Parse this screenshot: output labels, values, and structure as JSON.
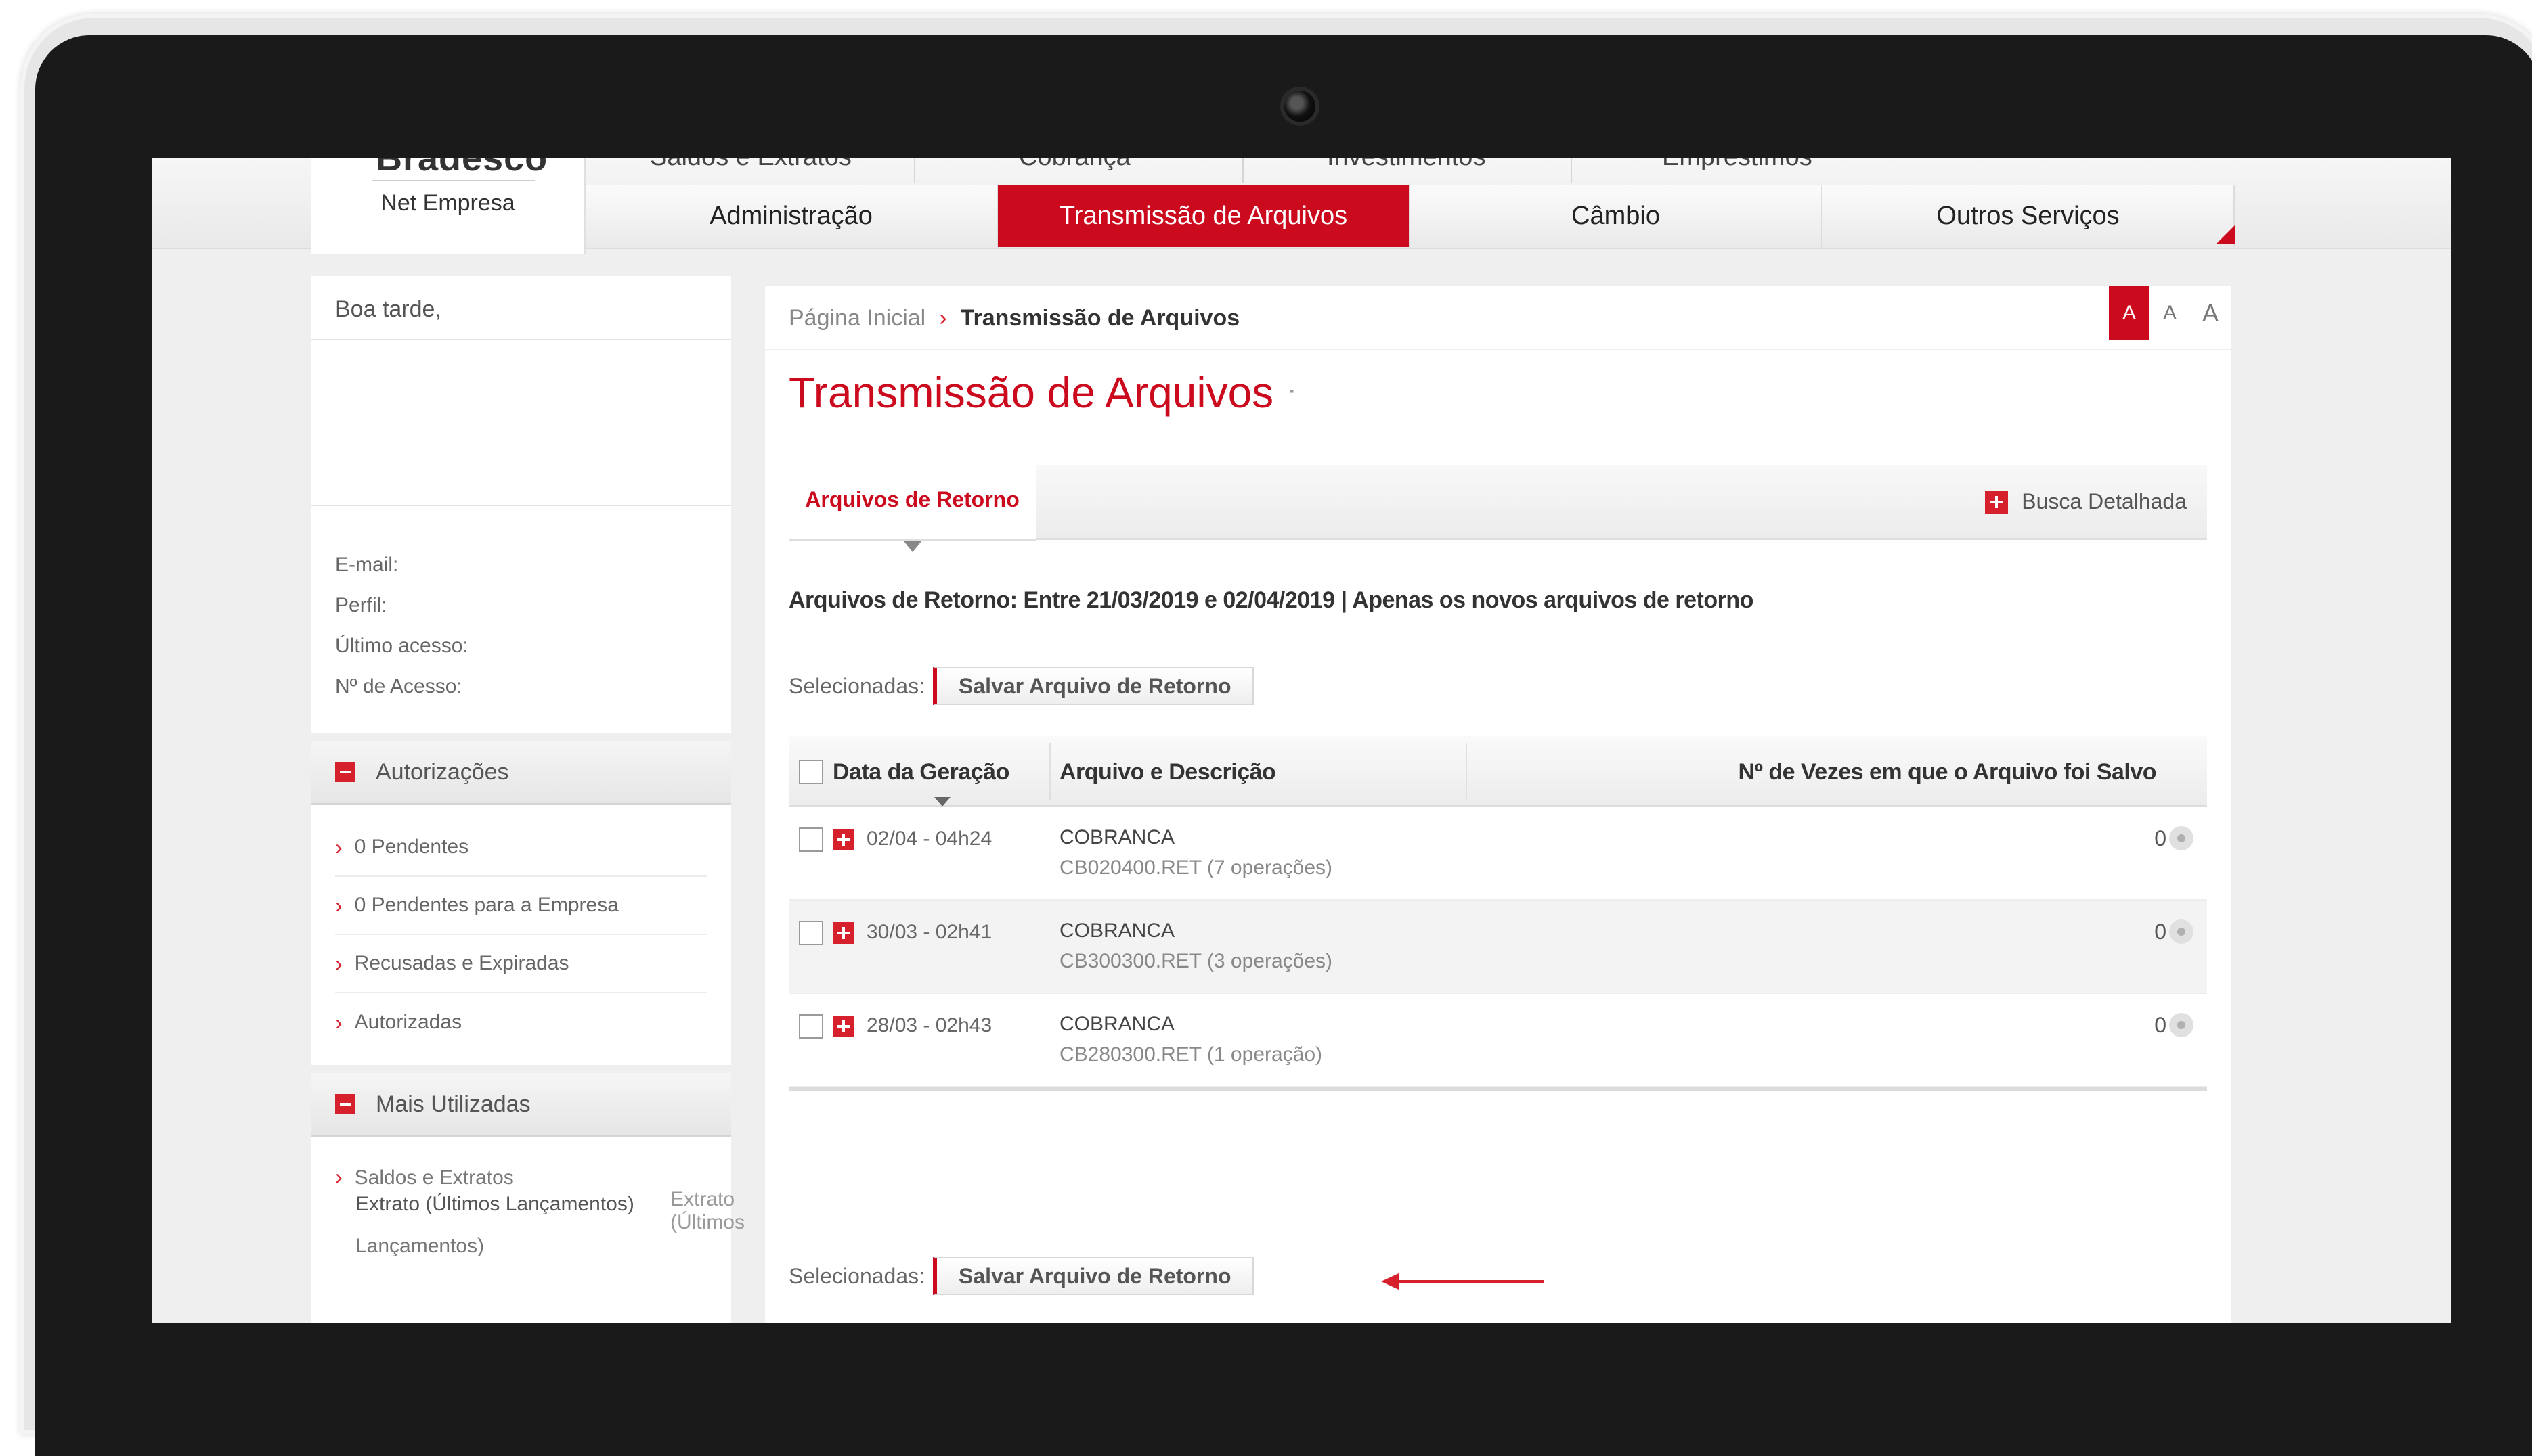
{
  "brand": {
    "name": "Bradesco",
    "product": "Net Empresa"
  },
  "nav": {
    "upper_tabs": [
      "Saldos e Extratos",
      "Cobrança",
      "Investimentos",
      "Empréstimos"
    ],
    "main_tabs": [
      "Administração",
      "Transmissão de Arquivos",
      "Câmbio",
      "Outros Serviços"
    ],
    "active_tab": "Transmissão de Arquivos"
  },
  "sidebar": {
    "greeting": "Boa tarde,",
    "info_labels": [
      "E-mail:",
      "Perfil:",
      "Último acesso:",
      "Nº de Acesso:"
    ],
    "autorizacoes": {
      "title": "Autorizações",
      "items": [
        "0 Pendentes",
        "0 Pendentes para a Empresa",
        "Recusadas e Expiradas",
        "Autorizadas"
      ]
    },
    "mais_utilizadas": {
      "title": "Mais Utilizadas",
      "group": "Saldos e Extratos",
      "item_a": "Extrato (Últimos Lançamentos)",
      "item_b": "Extrato (Últimos",
      "item_c": "Lançamentos)"
    }
  },
  "breadcrumb": {
    "home": "Página Inicial",
    "current": "Transmissão de Arquivos"
  },
  "font_size_controls": [
    "A",
    "A",
    "A"
  ],
  "page_title": "Transmissão de Arquivos",
  "subtab": {
    "label": "Arquivos de Retorno",
    "busca": "Busca Detalhada"
  },
  "filter_summary": "Arquivos de Retorno: Entre 21/03/2019 e 02/04/2019 | Apenas os novos arquivos de retorno",
  "selecionadas_label": "Selecionadas:",
  "save_button": "Salvar Arquivo de Retorno",
  "table": {
    "headers": [
      "Data da Geração",
      "Arquivo e Descrição",
      "Nº de Vezes em que o Arquivo foi Salvo"
    ],
    "rows": [
      {
        "date": "02/04 - 04h24",
        "type": "COBRANCA",
        "file": "CB020400.RET (7 operações)",
        "count": "0"
      },
      {
        "date": "30/03 - 02h41",
        "type": "COBRANCA",
        "file": "CB300300.RET (3 operações)",
        "count": "0"
      },
      {
        "date": "28/03 - 02h43",
        "type": "COBRANCA",
        "file": "CB280300.RET (1 operação)",
        "count": "0"
      }
    ]
  },
  "colors": {
    "brand_red": "#cc0a1e",
    "accent_red": "#d6202c"
  }
}
